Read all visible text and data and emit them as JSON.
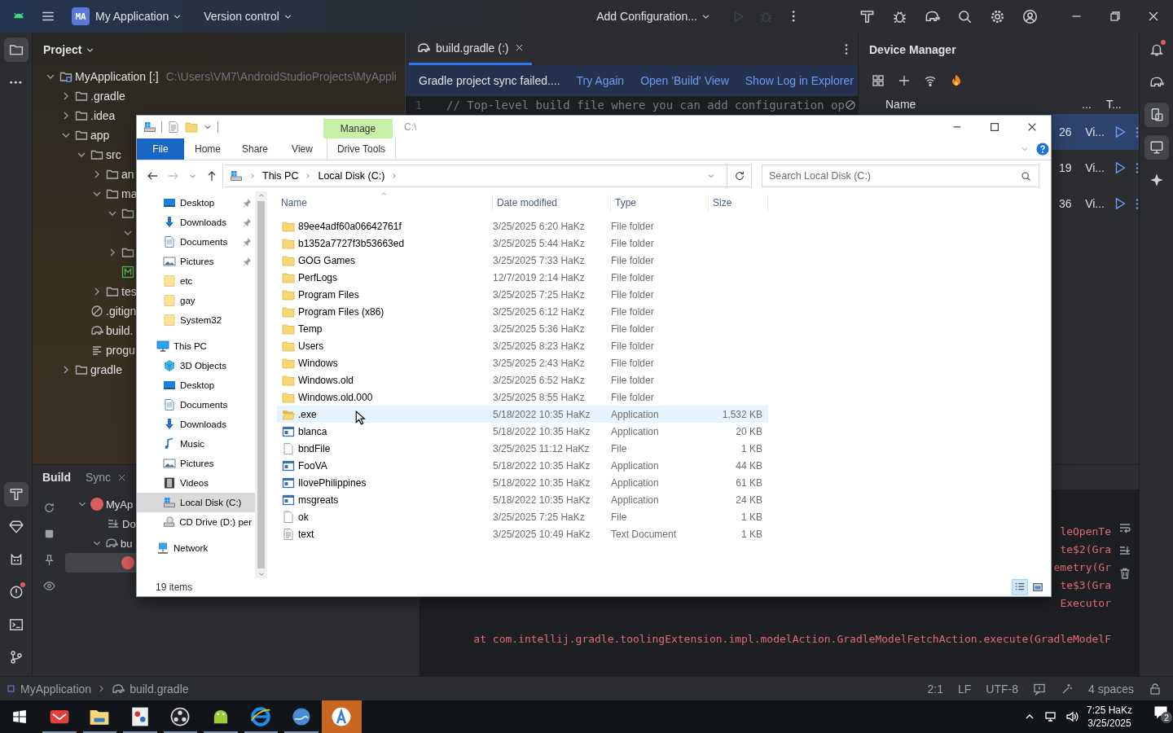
{
  "ide": {
    "title_bar": {
      "project_badge": "MA",
      "project": "My Application",
      "vcs": "Version control",
      "run_config": "Add Configuration...",
      "actions": [
        {
          "kind": "run",
          "disabled": true
        },
        {
          "kind": "debug",
          "disabled": true
        }
      ],
      "tools": [
        {
          "kind": "build-run"
        },
        {
          "kind": "debug-attach"
        },
        {
          "kind": "sync"
        },
        {
          "kind": "search"
        },
        {
          "kind": "settings"
        },
        {
          "kind": "account"
        }
      ]
    },
    "left_stripe": {
      "top": [
        {
          "kind": "project",
          "selected": true
        },
        {
          "kind": "more",
          "selected": false
        }
      ],
      "bottom": [
        {
          "kind": "build",
          "selected": true,
          "badge": false
        },
        {
          "kind": "gem",
          "selected": false,
          "badge": false
        },
        {
          "kind": "cat",
          "selected": false,
          "badge": false
        },
        {
          "kind": "problems",
          "selected": false,
          "badge": true
        },
        {
          "kind": "terminal",
          "selected": false,
          "badge": false
        },
        {
          "kind": "git",
          "selected": false,
          "badge": false
        }
      ]
    },
    "project_panel": {
      "title": "Project",
      "tree": [
        {
          "label": "MyApplication [:]",
          "path": "C:\\Users\\VM7\\AndroidStudioProjects\\MyAppli",
          "kind": "module",
          "expanded": true,
          "children": [
            {
              "label": ".gradle",
              "kind": "folder",
              "expanded": false
            },
            {
              "label": ".idea",
              "kind": "folder",
              "expanded": false
            },
            {
              "label": "app",
              "kind": "folder",
              "expanded": true,
              "children": [
                {
                  "label": "src",
                  "kind": "folder",
                  "expanded": true,
                  "children": [
                    {
                      "label": "an",
                      "kind": "folder",
                      "expanded": false
                    },
                    {
                      "label": "ma",
                      "kind": "folder",
                      "expanded": true,
                      "children": [
                        {
                          "kind": "folder",
                          "expanded": true,
                          "children": [
                            {
                              "expanded": true
                            }
                          ]
                        },
                        {
                          "kind": "folder",
                          "expanded": false
                        },
                        {
                          "kind": "manifest"
                        }
                      ]
                    },
                    {
                      "label": "tes",
                      "kind": "folder",
                      "expanded": false
                    }
                  ]
                },
                {
                  "label": ".gitign",
                  "kind": "ignore"
                },
                {
                  "label": "build.",
                  "kind": "gradle"
                },
                {
                  "label": "progu",
                  "kind": "text"
                }
              ]
            },
            {
              "label": "gradle",
              "kind": "folder",
              "expanded": false
            }
          ]
        }
      ]
    },
    "editor": {
      "tabs": [
        {
          "label": "build.gradle (:)",
          "selected": true
        }
      ],
      "banner": {
        "message": "Gradle project sync failed....",
        "actions": [
          "Try Again",
          "Open 'Build' View",
          "Show Log in Explorer"
        ]
      },
      "lines": [
        {
          "number": "1",
          "text": "// Top-level build file where you can add configuration op"
        }
      ]
    },
    "device_manager": {
      "title": "Device Manager",
      "toolbar": [
        {
          "kind": "grid"
        },
        {
          "kind": "add"
        },
        {
          "kind": "wifi"
        },
        {
          "kind": "fire"
        }
      ],
      "columns": [
        "Name",
        "...",
        "T..."
      ],
      "devices": [
        {
          "api": "26",
          "name": "Vi...",
          "selected": true
        },
        {
          "api": "19",
          "name": "Vi...",
          "selected": false
        },
        {
          "api": "36",
          "name": "Vi...",
          "selected": false
        }
      ]
    },
    "right_stripe": [
      {
        "kind": "notifications",
        "selected": false,
        "badge": true
      },
      {
        "kind": "sync",
        "selected": false,
        "badge": false
      },
      {
        "kind": "device",
        "selected": true,
        "badge": false
      },
      {
        "kind": "mirror",
        "selected": true,
        "badge": false
      },
      {
        "kind": "sparkle",
        "selected": false,
        "badge": false
      }
    ],
    "build_panel": {
      "tabs": [
        {
          "label": "Build",
          "selected": true,
          "closable": false
        },
        {
          "label": "Sync",
          "selected": false,
          "closable": true
        }
      ],
      "toolbar": [
        {
          "kind": "refresh"
        },
        {
          "kind": "stop"
        },
        {
          "kind": "pin"
        },
        {
          "kind": "eye"
        }
      ],
      "tree": [
        {
          "label": "MyAp",
          "kind": "error",
          "expanded": true,
          "selected": false,
          "children": [
            {
              "label": "Do",
              "kind": "download",
              "selected": false
            },
            {
              "label": "bu",
              "kind": "gradle",
              "expanded": true,
              "selected": false,
              "children": [
                {
                  "kind": "error",
                  "selected": true
                }
              ]
            }
          ]
        }
      ],
      "console": [
        "leOpenTe",
        "te$2(Gra",
        "emetry(Gr",
        "te$3(Gra",
        "Executor",
        "at com.intellij.gradle.toolingExtension.impl.modelAction.GradleModelFetchAction.execute(GradleModelF"
      ],
      "console_tools": [
        {
          "kind": "wrap"
        },
        {
          "kind": "scroll-end"
        },
        {
          "kind": "trash"
        }
      ]
    },
    "status_bar": {
      "breadcrumb": [
        {
          "label": "MyApplication",
          "kind": "module"
        },
        {
          "label": "build.gradle",
          "kind": "gradle"
        }
      ],
      "position": "2:1",
      "line_ending": "LF",
      "encoding": "UTF-8",
      "indent": "4 spaces"
    }
  },
  "explorer": {
    "title": "C:\\",
    "context_tab": "Manage",
    "ribbon_tabs": [
      {
        "label": "File",
        "kind": "file"
      },
      {
        "label": "Home",
        "kind": "tab"
      },
      {
        "label": "Share",
        "kind": "tab"
      },
      {
        "label": "View",
        "kind": "tab"
      },
      {
        "label": "Drive Tools",
        "kind": "context"
      }
    ],
    "nav_buttons": [
      {
        "kind": "back",
        "disabled": false
      },
      {
        "kind": "forward",
        "disabled": true
      },
      {
        "kind": "recent",
        "disabled": false
      },
      {
        "kind": "up",
        "disabled": false
      }
    ],
    "breadcrumb": [
      "This PC",
      "Local Disk (C:)"
    ],
    "search": {
      "placeholder": "Search Local Disk (C:)"
    },
    "nav": {
      "quick_access": [
        {
          "label": "Desktop",
          "kind": "desktop",
          "pinned": true,
          "selected": false
        },
        {
          "label": "Downloads",
          "kind": "downloads",
          "pinned": true,
          "selected": false
        },
        {
          "label": "Documents",
          "kind": "documents",
          "pinned": true,
          "selected": false
        },
        {
          "label": "Pictures",
          "kind": "pictures",
          "pinned": true,
          "selected": false
        },
        {
          "label": "etc",
          "kind": "folder",
          "pinned": false,
          "selected": false
        },
        {
          "label": "gay",
          "kind": "folder",
          "pinned": false,
          "selected": false
        },
        {
          "label": "System32",
          "kind": "folder",
          "pinned": false,
          "selected": false
        }
      ],
      "this_pc": {
        "label": "This PC",
        "kind": "pc",
        "selected": false,
        "children": [
          {
            "label": "3D Objects",
            "kind": "objects",
            "selected": false
          },
          {
            "label": "Desktop",
            "kind": "desktop",
            "selected": false
          },
          {
            "label": "Documents",
            "kind": "documents",
            "selected": false
          },
          {
            "label": "Downloads",
            "kind": "downloads",
            "selected": false
          },
          {
            "label": "Music",
            "kind": "music",
            "selected": false
          },
          {
            "label": "Pictures",
            "kind": "pictures",
            "selected": false
          },
          {
            "label": "Videos",
            "kind": "videos",
            "selected": false
          },
          {
            "label": "Local Disk (C:)",
            "kind": "drive",
            "selected": true
          },
          {
            "label": "CD Drive (D:) per",
            "kind": "cd",
            "selected": false
          }
        ]
      },
      "network": {
        "label": "Network",
        "kind": "network",
        "selected": false
      }
    },
    "columns": [
      "Name",
      "Date modified",
      "Type",
      "Size"
    ],
    "files": [
      {
        "name": "89ee4adf60a06642761f",
        "date": "3/25/2025 6:20 HaKz",
        "type": "File folder",
        "kind": "folder",
        "hovered": false
      },
      {
        "name": "b1352a7727f3b53663ed",
        "date": "3/25/2025 5:44 HaKz",
        "type": "File folder",
        "kind": "folder",
        "hovered": false
      },
      {
        "name": "GOG Games",
        "date": "3/25/2025 7:33 HaKz",
        "type": "File folder",
        "kind": "folder",
        "hovered": false
      },
      {
        "name": "PerfLogs",
        "date": "12/7/2019 2:14 HaKz",
        "type": "File folder",
        "kind": "folder",
        "hovered": false
      },
      {
        "name": "Program Files",
        "date": "3/25/2025 7:25 HaKz",
        "type": "File folder",
        "kind": "folder",
        "hovered": false
      },
      {
        "name": "Program Files (x86)",
        "date": "3/25/2025 6:12 HaKz",
        "type": "File folder",
        "kind": "folder",
        "hovered": false
      },
      {
        "name": "Temp",
        "date": "3/25/2025 5:36 HaKz",
        "type": "File folder",
        "kind": "folder",
        "hovered": false
      },
      {
        "name": "Users",
        "date": "3/25/2025 8:23 HaKz",
        "type": "File folder",
        "kind": "folder",
        "hovered": false
      },
      {
        "name": "Windows",
        "date": "3/25/2025 2:43 HaKz",
        "type": "File folder",
        "kind": "folder",
        "hovered": false
      },
      {
        "name": "Windows.old",
        "date": "3/25/2025 6:52 HaKz",
        "type": "File folder",
        "kind": "folder",
        "hovered": false
      },
      {
        "name": "Windows.old.000",
        "date": "3/25/2025 8:55 HaKz",
        "type": "File folder",
        "kind": "folder",
        "hovered": false
      },
      {
        "name": ".exe",
        "date": "5/18/2022 10:35 HaKz",
        "type": "Application",
        "size": "1,532 KB",
        "kind": "open-folder",
        "hovered": true
      },
      {
        "name": "blanca",
        "date": "5/18/2022 10:35 HaKz",
        "type": "Application",
        "size": "20 KB",
        "kind": "app",
        "hovered": false
      },
      {
        "name": "bndFile",
        "date": "3/25/2025 11:12 HaKz",
        "type": "File",
        "size": "1 KB",
        "kind": "file",
        "hovered": false
      },
      {
        "name": "FooVA",
        "date": "5/18/2022 10:35 HaKz",
        "type": "Application",
        "size": "44 KB",
        "kind": "app",
        "hovered": false
      },
      {
        "name": "IlovePhilippines",
        "date": "5/18/2022 10:35 HaKz",
        "type": "Application",
        "size": "61 KB",
        "kind": "app",
        "hovered": false
      },
      {
        "name": "msgreats",
        "date": "5/18/2022 10:35 HaKz",
        "type": "Application",
        "size": "24 KB",
        "kind": "app",
        "hovered": false
      },
      {
        "name": "ok",
        "date": "3/25/2025 7:25 HaKz",
        "type": "File",
        "size": "1 KB",
        "kind": "file",
        "hovered": false
      },
      {
        "name": "text",
        "date": "3/25/2025 10:49 HaKz",
        "type": "Text Document",
        "size": "1 KB",
        "kind": "text",
        "hovered": false
      }
    ],
    "status": "19 items",
    "views": [
      {
        "kind": "details",
        "selected": true
      },
      {
        "kind": "tiles",
        "selected": false
      }
    ]
  },
  "taskbar": {
    "apps": [
      {
        "kind": "fox",
        "running": true,
        "active": false
      },
      {
        "kind": "files",
        "running": true,
        "active": false
      },
      {
        "kind": "paint",
        "running": true,
        "active": false
      },
      {
        "kind": "recorder",
        "running": true,
        "active": false
      },
      {
        "kind": "android",
        "running": true,
        "active": false
      },
      {
        "kind": "browser",
        "running": true,
        "active": false
      },
      {
        "kind": "globe",
        "running": true,
        "active": false
      },
      {
        "kind": "studio",
        "running": false,
        "active": true
      }
    ],
    "time": "7:25 HaKz",
    "date": "3/25/2025",
    "notifications": "2"
  }
}
